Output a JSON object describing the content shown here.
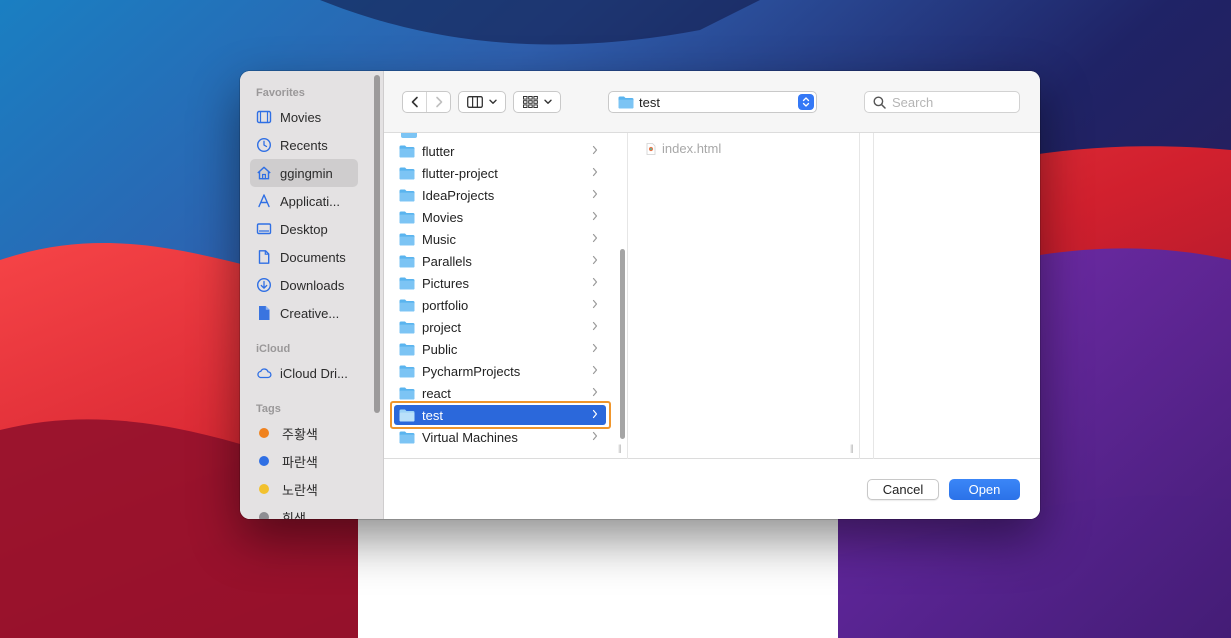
{
  "sidebar": {
    "favorites_header": "Favorites",
    "favorites": [
      {
        "label": "Movies",
        "icon": "film-icon"
      },
      {
        "label": "Recents",
        "icon": "clock-icon"
      },
      {
        "label": "ggingmin",
        "icon": "home-icon",
        "active": true
      },
      {
        "label": "Applicati...",
        "icon": "applications-icon"
      },
      {
        "label": "Desktop",
        "icon": "desktop-icon"
      },
      {
        "label": "Documents",
        "icon": "document-icon"
      },
      {
        "label": "Downloads",
        "icon": "download-icon"
      },
      {
        "label": "Creative...",
        "icon": "file-icon"
      }
    ],
    "icloud_header": "iCloud",
    "icloud": [
      {
        "label": "iCloud Dri...",
        "icon": "cloud-icon"
      }
    ],
    "tags_header": "Tags",
    "tags": [
      {
        "label": "주황색",
        "color": "#f0821e"
      },
      {
        "label": "파란색",
        "color": "#2f6fe4"
      },
      {
        "label": "노란색",
        "color": "#f2c12e"
      },
      {
        "label": "회색",
        "color": "#8e8e93"
      }
    ]
  },
  "toolbar": {
    "path_label": "test",
    "search_placeholder": "Search"
  },
  "browser": {
    "folders": [
      {
        "label": "flutter"
      },
      {
        "label": "flutter-project"
      },
      {
        "label": "IdeaProjects"
      },
      {
        "label": "Movies"
      },
      {
        "label": "Music"
      },
      {
        "label": "Parallels"
      },
      {
        "label": "Pictures"
      },
      {
        "label": "portfolio"
      },
      {
        "label": "project"
      },
      {
        "label": "Public"
      },
      {
        "label": "PycharmProjects"
      },
      {
        "label": "react"
      },
      {
        "label": "test",
        "selected": true
      },
      {
        "label": "Virtual Machines"
      }
    ],
    "files": [
      {
        "label": "index.html"
      }
    ]
  },
  "footer": {
    "cancel_label": "Cancel",
    "open_label": "Open"
  },
  "colors": {
    "accent": "#2b68db",
    "selection_outline": "#f0962c",
    "folder": "#5ab4ef"
  }
}
